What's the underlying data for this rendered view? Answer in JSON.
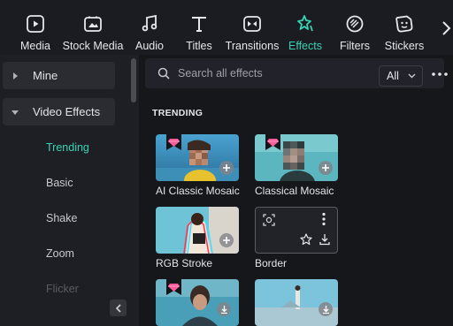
{
  "toolbar": {
    "items": [
      {
        "label": "Media",
        "icon": "media-icon"
      },
      {
        "label": "Stock Media",
        "icon": "stock-media-icon"
      },
      {
        "label": "Audio",
        "icon": "audio-icon"
      },
      {
        "label": "Titles",
        "icon": "titles-icon"
      },
      {
        "label": "Transitions",
        "icon": "transitions-icon"
      },
      {
        "label": "Effects",
        "icon": "effects-icon",
        "active": true
      },
      {
        "label": "Filters",
        "icon": "filters-icon"
      },
      {
        "label": "Stickers",
        "icon": "stickers-icon"
      }
    ]
  },
  "sidebar": {
    "groups": [
      {
        "label": "Mine",
        "expanded": false
      },
      {
        "label": "Video Effects",
        "expanded": true
      }
    ],
    "subitems": [
      {
        "label": "Trending",
        "active": true
      },
      {
        "label": "Basic"
      },
      {
        "label": "Shake"
      },
      {
        "label": "Zoom"
      },
      {
        "label": "Flicker"
      }
    ]
  },
  "search": {
    "placeholder": "Search all effects",
    "value": ""
  },
  "filter": {
    "selected": "All"
  },
  "section": {
    "title": "TRENDING"
  },
  "effects": [
    {
      "name": "AI Classic Mosaic",
      "premium": true,
      "action": "add"
    },
    {
      "name": "Classical Mosaic",
      "premium": true,
      "action": "add"
    },
    {
      "name": "RGB Stroke",
      "premium": false,
      "action": "add"
    },
    {
      "name": "Border",
      "premium": false,
      "action": "download"
    },
    {
      "name": "",
      "premium": true,
      "action": "download"
    },
    {
      "name": "",
      "premium": false,
      "action": "download"
    }
  ],
  "colors": {
    "accent": "#37d3b5",
    "premium_gem": "#ff5c9a",
    "background": "#16171b"
  }
}
